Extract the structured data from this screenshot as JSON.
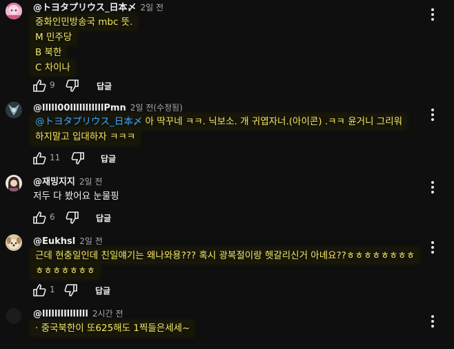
{
  "comments": [
    {
      "author": "@トヨタプリウス_日本〆",
      "time": "2일 전",
      "lines": [
        "중화인민방송국 mbc 뜻.",
        "M 민주당",
        "B 북한",
        "C 차이나"
      ],
      "likes": "9",
      "reply_label": "답글"
    },
    {
      "author": "@lllll00lllllllllllPmn",
      "time": "2일 전(수정됨)",
      "mention": "@トヨタプリウス_日本〆",
      "lines": [
        " 아 딱꾸네 ㅋㅋ. 닉보소. 개 귀엽자너.(아이콘) .ㅋㅋ 윤거니 그리워",
        "하지말고 입대하자 ㅋㅋㅋ"
      ],
      "likes": "11",
      "reply_label": "답글"
    },
    {
      "author": "@재밍지지",
      "time": "2일 전",
      "lines": [
        "저두  다 봤어요  눈물핑"
      ],
      "likes": "6",
      "reply_label": "답글"
    },
    {
      "author": "@Eukhsl",
      "time": "2일 전",
      "lines": [
        "근데 현충일인데 친일얘기는 왜나와용??? 혹시 광복절이랑 헷갈리신거 아녜요??ㅎㅎㅎㅎㅎㅎㅎㅎ",
        "ㅎㅎㅎㅎㅎㅎㅎ"
      ],
      "likes": "1",
      "reply_label": "답글"
    },
    {
      "author": "@lllllllllllllll",
      "time": "2시간 전",
      "lines": [
        "· 중국북한이 또625해도 1찍들은세세~"
      ]
    }
  ],
  "colors": {
    "background": "#0f0f0f",
    "text": "#f1f1f1",
    "secondary": "#aaaaaa",
    "mention": "#3ea6ff",
    "highlight_text": "#f5e663"
  }
}
